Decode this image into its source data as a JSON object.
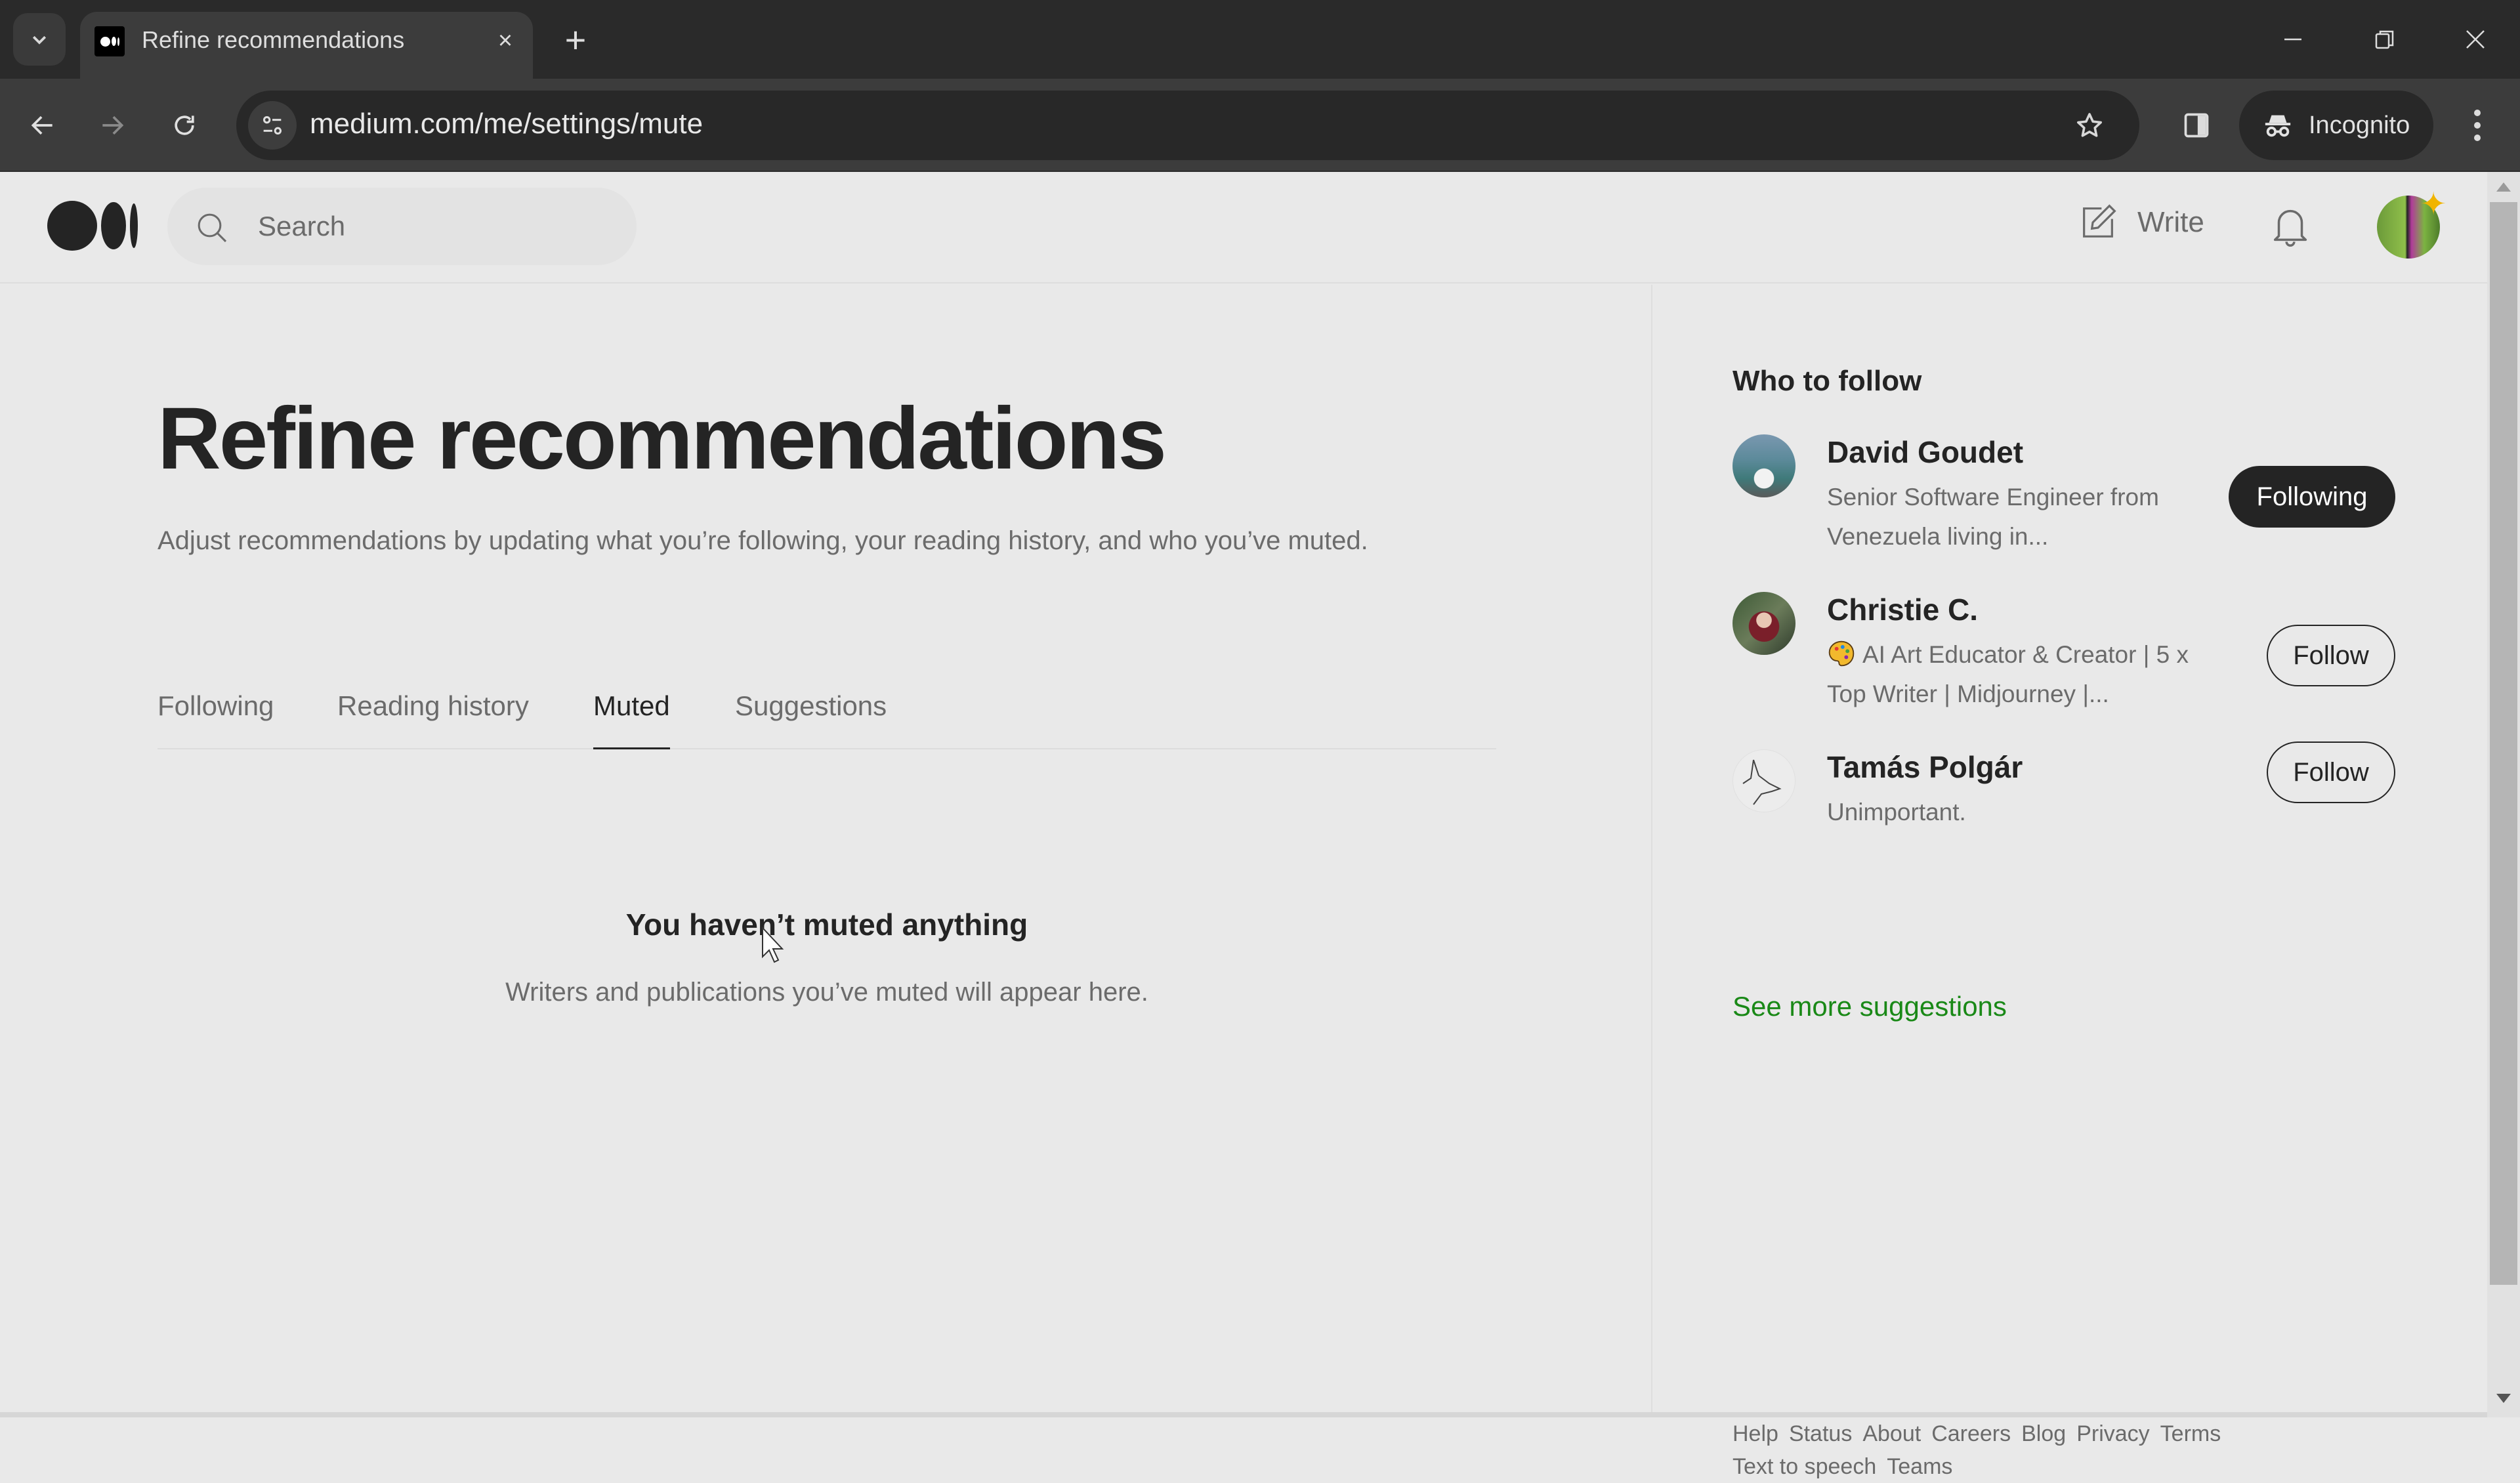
{
  "browser": {
    "tab_title": "Refine recommendations",
    "tab_close_icon": "×",
    "new_tab_icon": "+",
    "url": "medium.com/me/settings/mute",
    "incognito_label": "Incognito",
    "window_controls": {
      "minimize": "—",
      "restore": "❐",
      "close": "✕"
    }
  },
  "header": {
    "search_placeholder": "Search",
    "write_label": "Write",
    "sparkle_icon": "✦"
  },
  "main": {
    "title": "Refine recommendations",
    "subtitle": "Adjust recommendations by updating what you’re following, your reading history, and who you’ve muted.",
    "tabs": [
      {
        "label": "Following",
        "active": false
      },
      {
        "label": "Reading history",
        "active": false
      },
      {
        "label": "Muted",
        "active": true
      },
      {
        "label": "Suggestions",
        "active": false
      }
    ],
    "empty_state": {
      "title": "You haven’t muted anything",
      "description": "Writers and publications you’ve muted will appear here."
    }
  },
  "sidebar": {
    "title": "Who to follow",
    "people": [
      {
        "name": "David Goudet",
        "bio": "Senior Software Engineer from Venezuela living in...",
        "button": "Following"
      },
      {
        "name": "Christie C.",
        "bio": "AI Art Educator & Creator | 5 x Top Writer | Midjourney |...",
        "bio_emoji": "palette",
        "button": "Follow"
      },
      {
        "name": "Tamás Polgár",
        "bio": "Unimportant.",
        "button": "Follow"
      }
    ],
    "see_more": "See more suggestions",
    "colors": {
      "accent_green": "#1a8917",
      "text_primary": "#242424",
      "text_secondary": "#6b6b6b"
    },
    "footer_links": [
      "Help",
      "Status",
      "About",
      "Careers",
      "Blog",
      "Privacy",
      "Terms",
      "Text to speech",
      "Teams"
    ]
  }
}
